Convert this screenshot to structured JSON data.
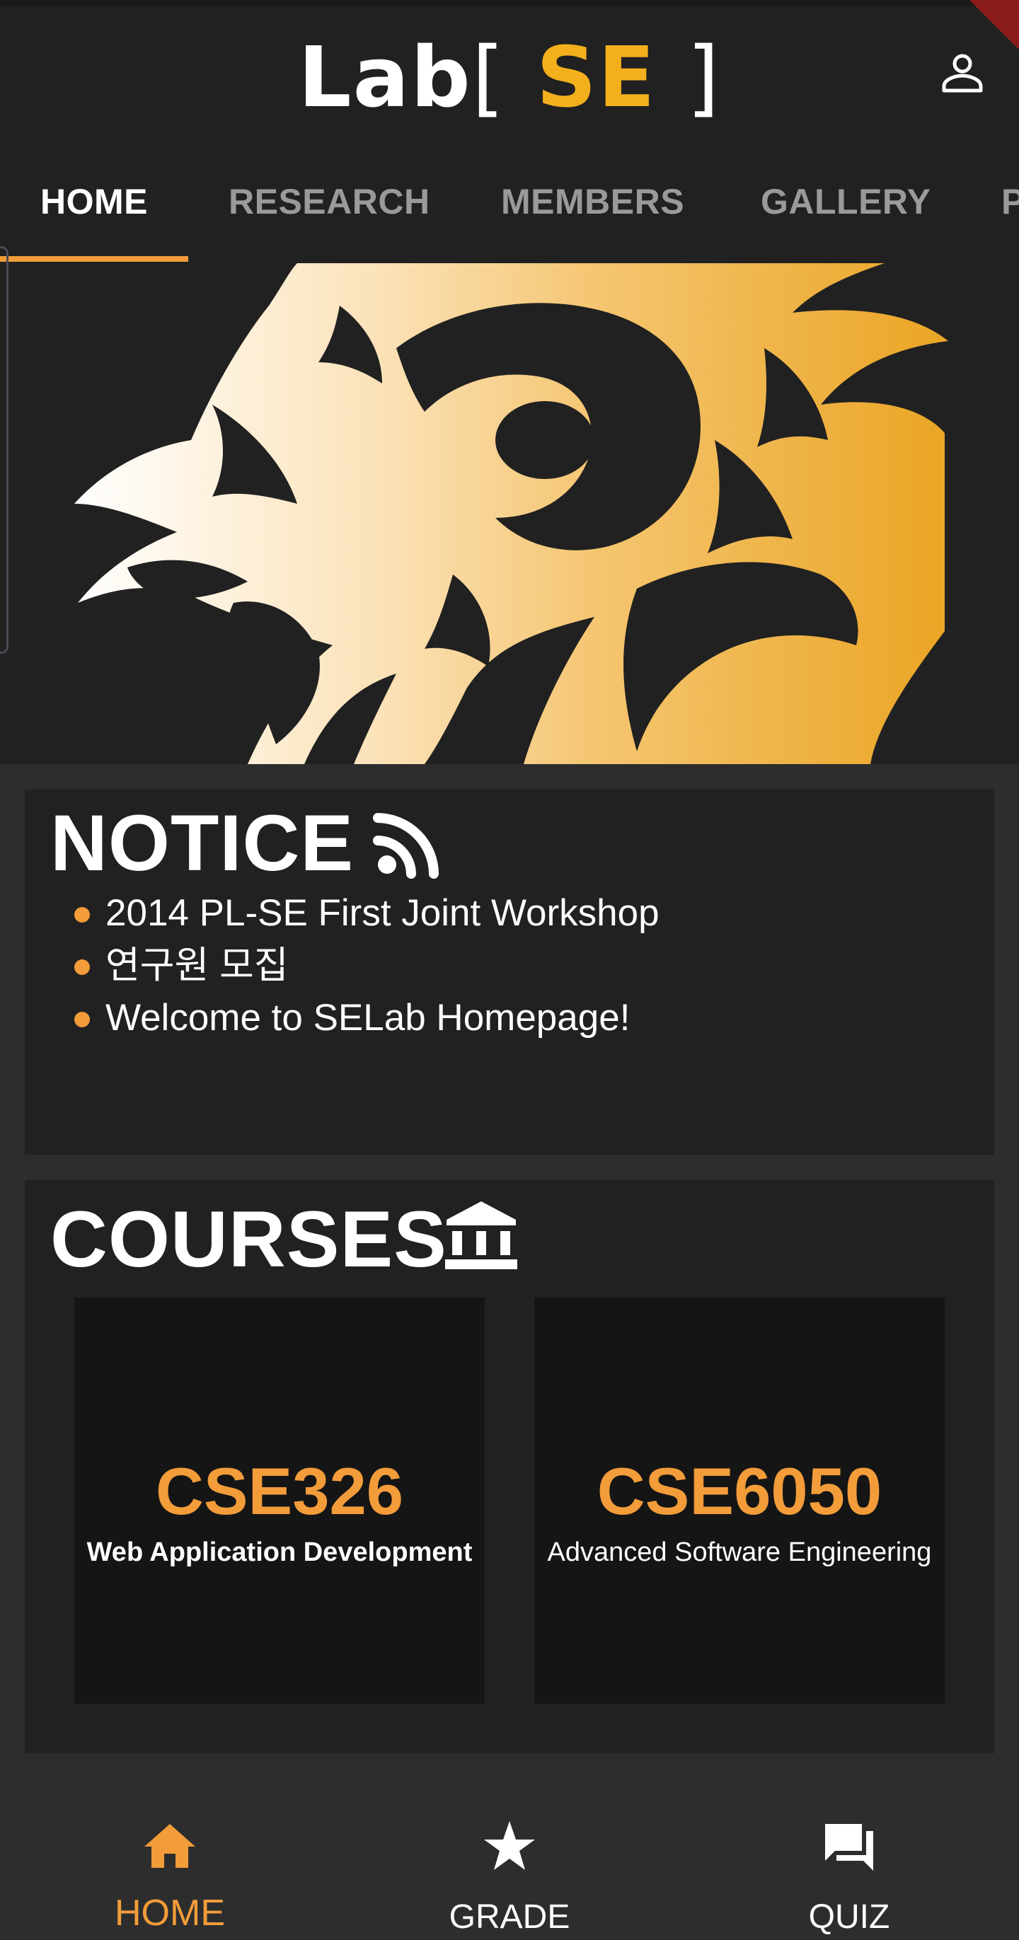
{
  "header": {
    "logo": {
      "lab": "Lab",
      "open_bracket": "[",
      "se": "SE",
      "close_bracket": "]"
    },
    "account_icon": "person-outline-icon"
  },
  "tabs": [
    {
      "label": "HOME",
      "active": true
    },
    {
      "label": "RESEARCH",
      "active": false
    },
    {
      "label": "MEMBERS",
      "active": false
    },
    {
      "label": "GALLERY",
      "active": false
    },
    {
      "label": "P",
      "active": false
    }
  ],
  "hero": {
    "image": "lion-emblem"
  },
  "notice": {
    "title": "NOTICE",
    "icon": "rss-feed-icon",
    "items": [
      "2014 PL-SE First Joint Workshop",
      "연구원 모집",
      "Welcome to SELab Homepage!"
    ]
  },
  "courses": {
    "title": "COURSES",
    "icon": "institution-icon",
    "items": [
      {
        "code": "CSE326",
        "name": "Web Application Development"
      },
      {
        "code": "CSE6050",
        "name": "Advanced Software Engineering"
      }
    ]
  },
  "bottom_nav": [
    {
      "label": "HOME",
      "icon": "home-icon",
      "active": true
    },
    {
      "label": "GRADE",
      "icon": "star-icon",
      "active": false
    },
    {
      "label": "QUIZ",
      "icon": "forum-icon",
      "active": false
    }
  ],
  "colors": {
    "accent": "#f39c3a",
    "logo_yellow": "#f4b01c",
    "background": "#2d2d2d",
    "card": "#212121",
    "tile": "#151515"
  }
}
